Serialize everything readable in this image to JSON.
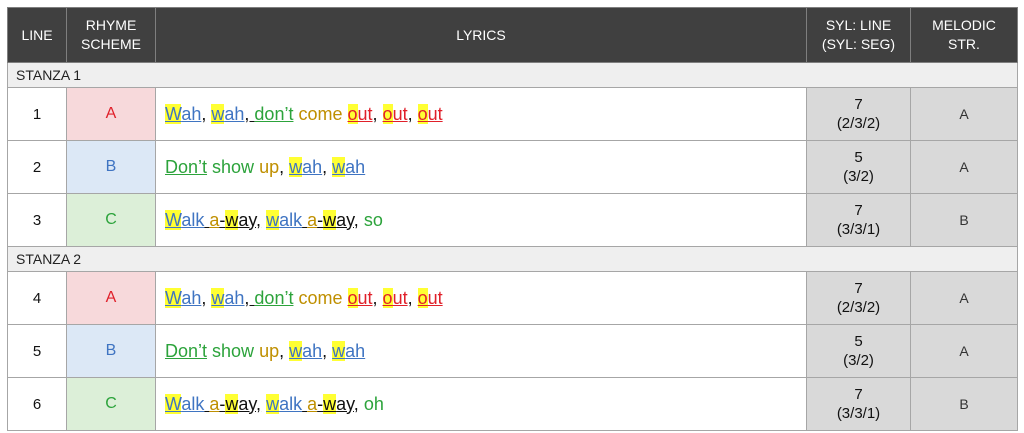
{
  "columns": {
    "line": "LINE",
    "rhyme": "RHYME SCHEME",
    "lyrics": "LYRICS",
    "syl": "SYL: LINE (SYL: SEG)",
    "melodic": "MELODIC STR."
  },
  "stanzas": [
    {
      "title": "STANZA 1",
      "rows": [
        {
          "line": "1",
          "rhyme": "A",
          "syl_line": "7",
          "syl_seg": "(2/3/2)",
          "melodic": "A",
          "lyrics": [
            {
              "t": "W",
              "c": "blue",
              "hl": true,
              "u": true
            },
            {
              "t": "ah",
              "c": "blue",
              "u": true
            },
            {
              "t": ", ",
              "c": "blk"
            },
            {
              "t": "w",
              "c": "blue",
              "hl": true,
              "u": true
            },
            {
              "t": "ah",
              "c": "blue",
              "u": true
            },
            {
              "t": ", ",
              "c": "blk",
              "u": true
            },
            {
              "t": "don’t",
              "c": "green",
              "u": true
            },
            {
              "t": " come ",
              "c": "gold"
            },
            {
              "t": "o",
              "c": "red",
              "hl": true,
              "u": true
            },
            {
              "t": "ut",
              "c": "red",
              "u": true
            },
            {
              "t": ", ",
              "c": "blk"
            },
            {
              "t": "o",
              "c": "red",
              "hl": true,
              "u": true
            },
            {
              "t": "ut",
              "c": "red",
              "u": true
            },
            {
              "t": ", ",
              "c": "blk"
            },
            {
              "t": "o",
              "c": "red",
              "hl": true,
              "u": true
            },
            {
              "t": "ut",
              "c": "red",
              "u": true
            }
          ]
        },
        {
          "line": "2",
          "rhyme": "B",
          "syl_line": "5",
          "syl_seg": "(3/2)",
          "melodic": "A",
          "lyrics": [
            {
              "t": "Don’t",
              "c": "green",
              "u": true
            },
            {
              "t": " show ",
              "c": "green"
            },
            {
              "t": "up",
              "c": "gold"
            },
            {
              "t": ", ",
              "c": "blk"
            },
            {
              "t": "w",
              "c": "blue",
              "hl": true,
              "u": true
            },
            {
              "t": "ah",
              "c": "blue",
              "u": true
            },
            {
              "t": ", ",
              "c": "blk"
            },
            {
              "t": "w",
              "c": "blue",
              "hl": true,
              "u": true
            },
            {
              "t": "ah",
              "c": "blue",
              "u": true
            }
          ]
        },
        {
          "line": "3",
          "rhyme": "C",
          "syl_line": "7",
          "syl_seg": "(3/3/1)",
          "melodic": "B",
          "lyrics": [
            {
              "t": "W",
              "c": "blue",
              "hl": true,
              "u": true
            },
            {
              "t": "alk",
              "c": "blue",
              "u": true
            },
            {
              "t": " ",
              "c": "blk",
              "u": true
            },
            {
              "t": "a",
              "c": "gold",
              "u": true
            },
            {
              "t": "-",
              "c": "blk",
              "u": true
            },
            {
              "t": "w",
              "c": "blk",
              "hl": true,
              "u": true
            },
            {
              "t": "ay,",
              "c": "blk",
              "u": true
            },
            {
              "t": " ",
              "c": "blk"
            },
            {
              "t": "w",
              "c": "blue",
              "hl": true,
              "u": true
            },
            {
              "t": "alk",
              "c": "blue",
              "u": true
            },
            {
              "t": " ",
              "c": "blk",
              "u": true
            },
            {
              "t": "a",
              "c": "gold",
              "u": true
            },
            {
              "t": "-",
              "c": "blk",
              "u": true
            },
            {
              "t": "w",
              "c": "blk",
              "hl": true,
              "u": true
            },
            {
              "t": "ay,",
              "c": "blk",
              "u": true
            },
            {
              "t": " so",
              "c": "green"
            }
          ]
        }
      ]
    },
    {
      "title": "STANZA 2",
      "rows": [
        {
          "line": "4",
          "rhyme": "A",
          "syl_line": "7",
          "syl_seg": "(2/3/2)",
          "melodic": "A",
          "lyrics": [
            {
              "t": "W",
              "c": "blue",
              "hl": true,
              "u": true
            },
            {
              "t": "ah",
              "c": "blue",
              "u": true
            },
            {
              "t": ", ",
              "c": "blk"
            },
            {
              "t": "w",
              "c": "blue",
              "hl": true,
              "u": true
            },
            {
              "t": "ah",
              "c": "blue",
              "u": true
            },
            {
              "t": ", ",
              "c": "blk",
              "u": true
            },
            {
              "t": "don’t",
              "c": "green",
              "u": true
            },
            {
              "t": " come ",
              "c": "gold"
            },
            {
              "t": "o",
              "c": "red",
              "hl": true,
              "u": true
            },
            {
              "t": "ut",
              "c": "red",
              "u": true
            },
            {
              "t": ", ",
              "c": "blk"
            },
            {
              "t": "o",
              "c": "red",
              "hl": true,
              "u": true
            },
            {
              "t": "ut",
              "c": "red",
              "u": true
            },
            {
              "t": ", ",
              "c": "blk"
            },
            {
              "t": "o",
              "c": "red",
              "hl": true,
              "u": true
            },
            {
              "t": "ut",
              "c": "red",
              "u": true
            }
          ]
        },
        {
          "line": "5",
          "rhyme": "B",
          "syl_line": "5",
          "syl_seg": "(3/2)",
          "melodic": "A",
          "lyrics": [
            {
              "t": "Don’t",
              "c": "green",
              "u": true
            },
            {
              "t": " show ",
              "c": "green"
            },
            {
              "t": "up",
              "c": "gold"
            },
            {
              "t": ", ",
              "c": "blk"
            },
            {
              "t": "w",
              "c": "blue",
              "hl": true,
              "u": true
            },
            {
              "t": "ah",
              "c": "blue",
              "u": true
            },
            {
              "t": ", ",
              "c": "blk"
            },
            {
              "t": "w",
              "c": "blue",
              "hl": true,
              "u": true
            },
            {
              "t": "ah",
              "c": "blue",
              "u": true
            }
          ]
        },
        {
          "line": "6",
          "rhyme": "C",
          "syl_line": "7",
          "syl_seg": "(3/3/1)",
          "melodic": "B",
          "lyrics": [
            {
              "t": "W",
              "c": "blue",
              "hl": true,
              "u": true
            },
            {
              "t": "alk",
              "c": "blue",
              "u": true
            },
            {
              "t": " ",
              "c": "blk",
              "u": true
            },
            {
              "t": "a",
              "c": "gold",
              "u": true
            },
            {
              "t": "-",
              "c": "blk",
              "u": true
            },
            {
              "t": "w",
              "c": "blk",
              "hl": true,
              "u": true
            },
            {
              "t": "ay,",
              "c": "blk",
              "u": true
            },
            {
              "t": " ",
              "c": "blk"
            },
            {
              "t": "w",
              "c": "blue",
              "hl": true,
              "u": true
            },
            {
              "t": "alk",
              "c": "blue",
              "u": true
            },
            {
              "t": " ",
              "c": "blk",
              "u": true
            },
            {
              "t": "a",
              "c": "gold",
              "u": true
            },
            {
              "t": "-",
              "c": "blk",
              "u": true
            },
            {
              "t": "w",
              "c": "blk",
              "hl": true,
              "u": true
            },
            {
              "t": "ay,",
              "c": "blk",
              "u": true
            },
            {
              "t": " oh",
              "c": "green"
            }
          ]
        }
      ]
    }
  ]
}
